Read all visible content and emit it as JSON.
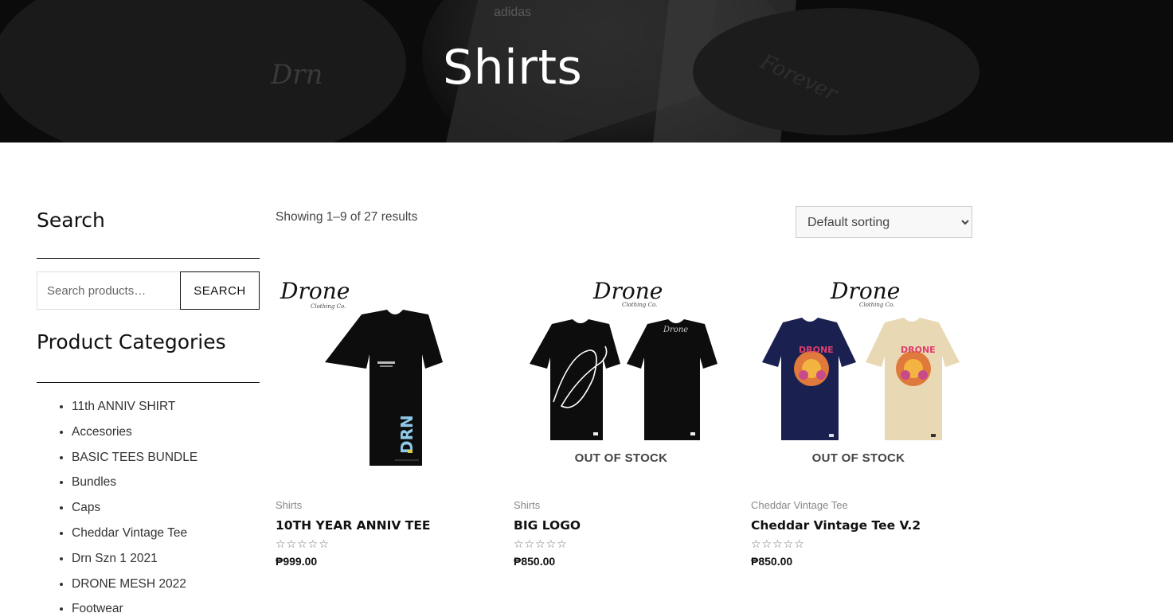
{
  "hero": {
    "title": "Shirts"
  },
  "sidebar": {
    "search_title": "Search",
    "search_placeholder": "Search products…",
    "search_button": "SEARCH",
    "categories_title": "Product Categories",
    "categories": [
      "11th ANNIV SHIRT",
      "Accesories",
      "BASIC TEES BUNDLE",
      "Bundles",
      "Caps",
      "Cheddar Vintage Tee",
      "Drn Szn 1 2021",
      "DRONE MESH 2022",
      "Footwear"
    ]
  },
  "shop": {
    "result_count": "Showing 1–9 of 27 results",
    "sort_selected": "Default sorting",
    "products": [
      {
        "category": "Shirts",
        "title": "10TH YEAR ANNIV TEE",
        "price": "₱999.00",
        "rating_stars": "☆☆☆☆☆",
        "out_of_stock": "",
        "brand": "Drone",
        "brand_sub": "Clothing Co."
      },
      {
        "category": "Shirts",
        "title": "BIG LOGO",
        "price": "₱850.00",
        "rating_stars": "☆☆☆☆☆",
        "out_of_stock": "OUT OF STOCK",
        "brand": "Drone",
        "brand_sub": "Clothing Co."
      },
      {
        "category": "Cheddar Vintage Tee",
        "title": "Cheddar Vintage Tee V.2",
        "price": "₱850.00",
        "rating_stars": "☆☆☆☆☆",
        "out_of_stock": "OUT OF STOCK",
        "brand": "Drone",
        "brand_sub": "Clothing Co."
      }
    ]
  },
  "colors": {
    "hero_bg": "#0b0b0b",
    "text": "#111111",
    "navy_shirt": "#1a2150",
    "beige_shirt": "#e9d8b4",
    "accent_blue": "#8fc8e8"
  }
}
